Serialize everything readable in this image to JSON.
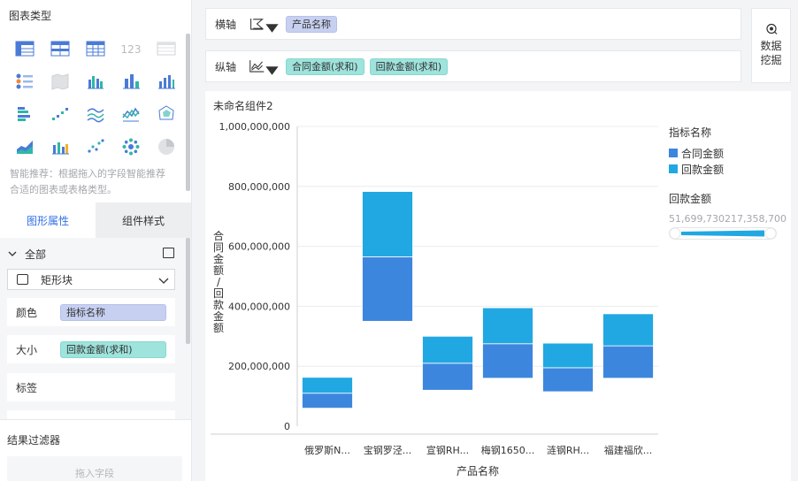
{
  "left_panel": {
    "title": "图表类型",
    "chart_types": [
      {
        "icon": "table-icon"
      },
      {
        "icon": "cross-table-icon"
      },
      {
        "icon": "detail-table-icon"
      },
      {
        "icon": "kpi-number-icon",
        "text": "123"
      },
      {
        "icon": "disabled-table-icon"
      },
      {
        "icon": "indicator-list-icon"
      },
      {
        "icon": "map-area-icon"
      },
      {
        "icon": "grouped-bar-icon"
      },
      {
        "icon": "column-chart-icon"
      },
      {
        "icon": "column-chart-alt-icon"
      },
      {
        "icon": "horizontal-bar-icon"
      },
      {
        "icon": "scatter-step-icon"
      },
      {
        "icon": "multi-line-icon"
      },
      {
        "icon": "line-area-icon"
      },
      {
        "icon": "radar-icon"
      },
      {
        "icon": "area-chart-icon"
      },
      {
        "icon": "combo-chart-icon"
      },
      {
        "icon": "scatter-icon"
      },
      {
        "icon": "bubble-icon"
      },
      {
        "icon": "pie-icon"
      }
    ],
    "hint": "智能推荐：根据拖入的字段智能推荐合适的图表或表格类型。",
    "tabs": [
      "图形属性",
      "组件样式"
    ],
    "all_label": "全部",
    "shape_select": "矩形块",
    "props": {
      "color_label": "颜色",
      "color_value": "指标名称",
      "size_label": "大小",
      "size_value": "回款金额(求和)",
      "tag_label": "标签"
    },
    "filter_title": "结果过滤器",
    "filter_drop": "拖入字段"
  },
  "axes": {
    "x_label": "横轴",
    "x_field": "产品名称",
    "y_label": "纵轴",
    "y_fields": [
      "合同金额(求和)",
      "回款金额(求和)"
    ]
  },
  "mining": {
    "line1": "数据",
    "line2": "挖掘"
  },
  "widget_title": "未命名组件2",
  "legend": {
    "title": "指标名称",
    "items": [
      "合同金额",
      "回款金额"
    ],
    "size_title": "回款金额",
    "size_min": "51,699,730",
    "size_max": "217,358,700"
  },
  "colors": {
    "contract": "#3d86de",
    "payment": "#21a8e2",
    "accent": "#3370e6"
  },
  "chart_data": {
    "type": "bar",
    "stacked": true,
    "floating": true,
    "title": "",
    "xlabel": "产品名称",
    "ylabel": "合同金额/回款金额",
    "ylim": [
      0,
      1000000000
    ],
    "yticks": [
      "0",
      "200,000,000",
      "400,000,000",
      "600,000,000",
      "800,000,000",
      "1,000,000,000"
    ],
    "categories": [
      "俄罗斯N...",
      "宝钢罗泾...",
      "宣钢RH...",
      "梅钢1650...",
      "涟钢RH...",
      "福建福欣..."
    ],
    "bases": [
      60000000,
      350000000,
      120000000,
      160000000,
      115000000,
      160000000
    ],
    "series": [
      {
        "name": "合同金额",
        "values": [
          50000000,
          215000000,
          90000000,
          115000000,
          80000000,
          108000000
        ]
      },
      {
        "name": "回款金额",
        "values": [
          53000000,
          218000000,
          90000000,
          120000000,
          82000000,
          107000000
        ]
      }
    ]
  }
}
